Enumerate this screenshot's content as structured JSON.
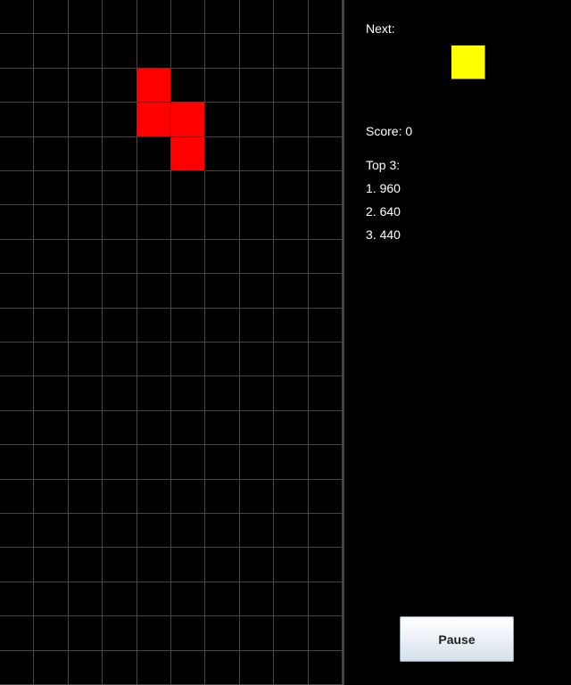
{
  "board": {
    "columns": 10,
    "rows": 20,
    "empty_color": "#000000",
    "grid_color": "#444444",
    "active_piece": {
      "shape": "S",
      "color": "#ff0000",
      "cells": [
        [
          4,
          2
        ],
        [
          4,
          3
        ],
        [
          5,
          3
        ],
        [
          5,
          4
        ]
      ]
    }
  },
  "panel": {
    "next_label": "Next:",
    "next_piece": {
      "shape": "O",
      "color": "#ffff00",
      "cells": [
        [
          0,
          0
        ]
      ]
    },
    "score_label": "Score:",
    "score_value": "0",
    "top_label": "Top 3:",
    "top_scores": [
      "1. 960",
      "2. 640",
      "3. 440"
    ],
    "pause_label": "Pause"
  }
}
